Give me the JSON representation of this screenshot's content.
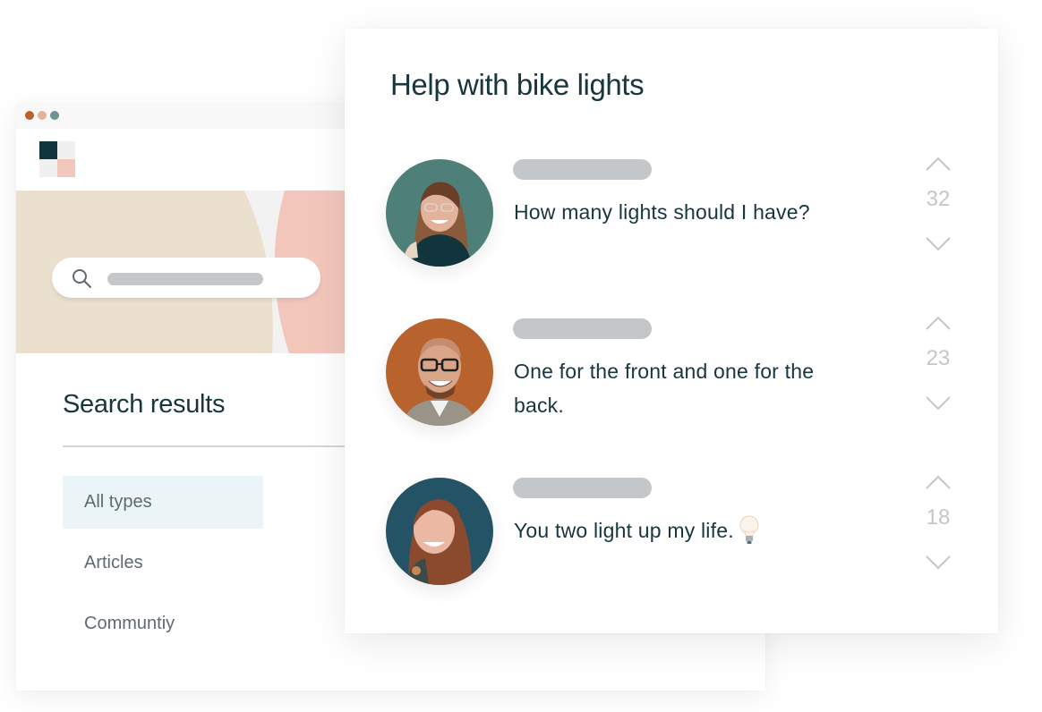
{
  "colors": {
    "dark_teal": "#12353d",
    "dot_1": "#b8622d",
    "dot_2": "#e5b39a",
    "dot_3": "#6d9393",
    "logo_light": "#f0f0f0",
    "logo_pink": "#f3c6bc",
    "hero_beige": "#ebdfce",
    "hero_gap": "#f2f2f2",
    "hero_pink": "#f3c6bc",
    "placeholder_gray": "#c3c7ca",
    "active_filter_bg": "#ebf5f8",
    "vote_gray": "#c3c7ca"
  },
  "back_window": {
    "search": {
      "icon": "search-icon",
      "placeholder": ""
    },
    "results_title": "Search results",
    "filters": [
      {
        "label": "All types",
        "active": true
      },
      {
        "label": "Articles",
        "active": false
      },
      {
        "label": "Communtiy",
        "active": false
      }
    ]
  },
  "thread": {
    "title": "Help with bike lights",
    "posts": [
      {
        "avatar": "avatar-woman-glasses",
        "avatar_bg": "#4e7f79",
        "text": "How many lights should I have?",
        "emoji": "",
        "votes": "32"
      },
      {
        "avatar": "avatar-man-glasses",
        "avatar_bg": "#b8622d",
        "text": "One for the front and one for the back.",
        "emoji": "",
        "votes": "23"
      },
      {
        "avatar": "avatar-woman-red-hair",
        "avatar_bg": "#255366",
        "text": "You two light up my life.",
        "emoji": "lightbulb-icon",
        "votes": "18"
      }
    ]
  }
}
